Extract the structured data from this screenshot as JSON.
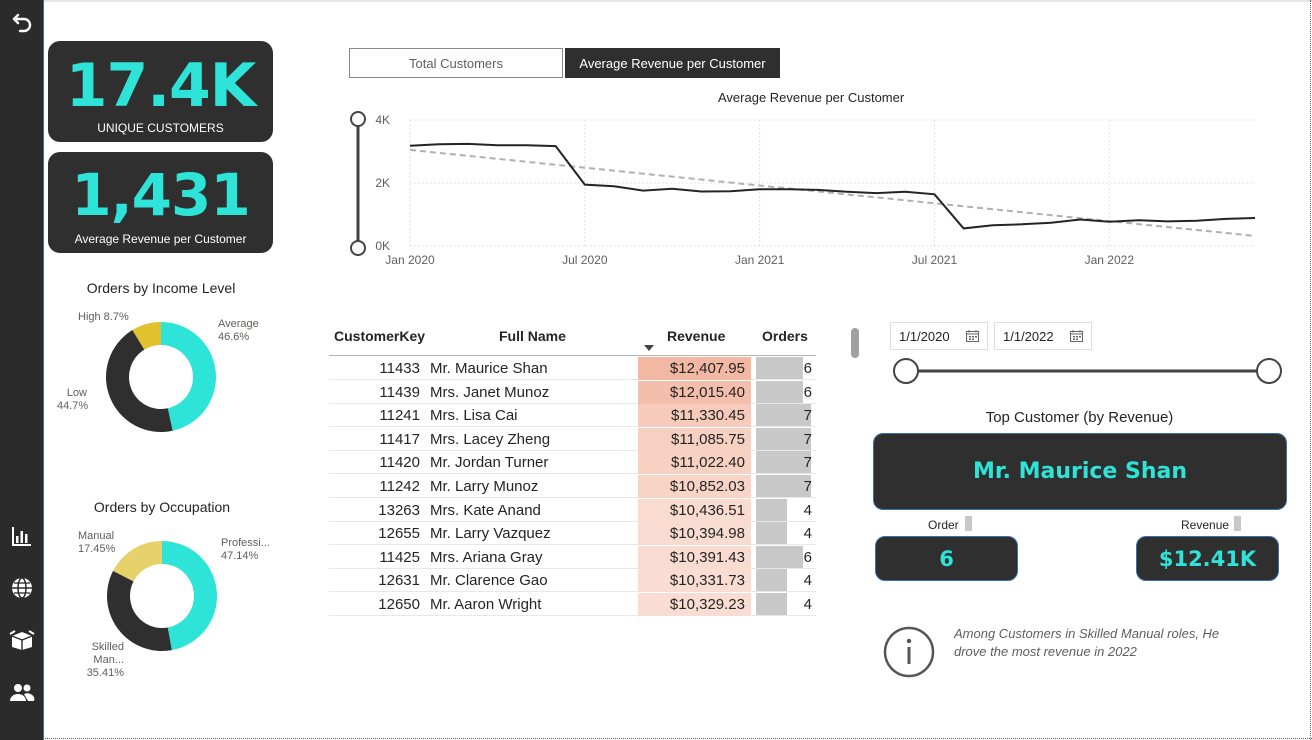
{
  "kpis": {
    "unique_customers": {
      "value": "17.4K",
      "label": "UNIQUE CUSTOMERS"
    },
    "avg_revenue": {
      "value": "1,431",
      "label": "Average Revenue per Customer"
    }
  },
  "sidebar": {
    "icons": [
      "back-arrow-icon",
      "bar-chart-icon",
      "globe-icon",
      "box-icon",
      "users-icon"
    ]
  },
  "donuts": {
    "income": {
      "title": "Orders by Income Level",
      "slices": [
        {
          "name": "Average",
          "pct": "46.6%",
          "value": 46.6,
          "color": "#2ee4d8"
        },
        {
          "name": "Low",
          "pct": "44.7%",
          "value": 44.7,
          "color": "#2f2f2f"
        },
        {
          "name": "High",
          "pct": "8.7%",
          "value": 8.7,
          "color": "#e2c12f"
        }
      ],
      "high_label": "High 8.7%"
    },
    "occupation": {
      "title": "Orders by Occupation",
      "slices": [
        {
          "name": "Professi...",
          "pct": "47.14%",
          "value": 47.14,
          "color": "#2ee4d8"
        },
        {
          "name": "Skilled Man...",
          "pct": "35.41%",
          "value": 35.41,
          "color": "#2f2f2f"
        },
        {
          "name": "Manual",
          "pct": "17.45%",
          "value": 17.45,
          "color": "#e6d26a"
        }
      ]
    }
  },
  "tabs": {
    "total_customers": "Total Customers",
    "avg_revenue": "Average Revenue per Customer",
    "active": "avg_revenue"
  },
  "chart_data": {
    "type": "line",
    "title": "Average Revenue per Customer",
    "x": [
      "2020-01",
      "2020-02",
      "2020-03",
      "2020-04",
      "2020-05",
      "2020-06",
      "2020-07",
      "2020-08",
      "2020-09",
      "2020-10",
      "2020-11",
      "2020-12",
      "2021-01",
      "2021-02",
      "2021-03",
      "2021-04",
      "2021-05",
      "2021-06",
      "2021-07",
      "2021-08",
      "2021-09",
      "2021-10",
      "2021-11",
      "2021-12",
      "2022-01",
      "2022-02",
      "2022-03",
      "2022-04",
      "2022-05",
      "2022-06"
    ],
    "series": [
      {
        "values": [
          3180,
          3230,
          3240,
          3200,
          3200,
          3170,
          1950,
          1900,
          1760,
          1820,
          1730,
          1740,
          1800,
          1800,
          1780,
          1720,
          1680,
          1720,
          1640,
          560,
          660,
          690,
          740,
          840,
          770,
          820,
          780,
          800,
          860,
          890
        ]
      }
    ],
    "trend": {
      "start": 3050,
      "end": 320
    },
    "x_ticks": [
      "Jan 2020",
      "Jul 2020",
      "Jan 2021",
      "Jul 2021",
      "Jan 2022"
    ],
    "y_ticks": [
      "0K",
      "2K",
      "4K"
    ],
    "ylim": [
      0,
      4000
    ],
    "grid": true
  },
  "table": {
    "headers": {
      "key": "CustomerKey",
      "name": "Full Name",
      "revenue": "Revenue",
      "orders": "Orders"
    },
    "rows": [
      {
        "key": "11433",
        "name": "Mr. Maurice Shan",
        "revenue": "$12,407.95",
        "rev_num": 12407.95,
        "orders": "6"
      },
      {
        "key": "11439",
        "name": "Mrs. Janet Munoz",
        "revenue": "$12,015.40",
        "rev_num": 12015.4,
        "orders": "6"
      },
      {
        "key": "11241",
        "name": "Mrs. Lisa Cai",
        "revenue": "$11,330.45",
        "rev_num": 11330.45,
        "orders": "7"
      },
      {
        "key": "11417",
        "name": "Mrs. Lacey Zheng",
        "revenue": "$11,085.75",
        "rev_num": 11085.75,
        "orders": "7"
      },
      {
        "key": "11420",
        "name": "Mr. Jordan Turner",
        "revenue": "$11,022.40",
        "rev_num": 11022.4,
        "orders": "7"
      },
      {
        "key": "11242",
        "name": "Mr. Larry Munoz",
        "revenue": "$10,852.03",
        "rev_num": 10852.03,
        "orders": "7"
      },
      {
        "key": "13263",
        "name": "Mrs. Kate Anand",
        "revenue": "$10,436.51",
        "rev_num": 10436.51,
        "orders": "4"
      },
      {
        "key": "12655",
        "name": "Mr. Larry Vazquez",
        "revenue": "$10,394.98",
        "rev_num": 10394.98,
        "orders": "4"
      },
      {
        "key": "11425",
        "name": "Mrs. Ariana Gray",
        "revenue": "$10,391.43",
        "rev_num": 10391.43,
        "orders": "6"
      },
      {
        "key": "12631",
        "name": "Mr. Clarence Gao",
        "revenue": "$10,331.73",
        "rev_num": 10331.73,
        "orders": "4"
      },
      {
        "key": "12650",
        "name": "Mr. Aaron Wright",
        "revenue": "$10,329.23",
        "rev_num": 10329.23,
        "orders": "4"
      }
    ]
  },
  "date_filter": {
    "start": "1/1/2020",
    "end": "1/1/2022"
  },
  "top_customer": {
    "title": "Top Customer (by Revenue)",
    "name": "Mr. Maurice Shan",
    "order_label": "Order",
    "order_value": "6",
    "revenue_label": "Revenue",
    "revenue_value": "$12.41K"
  },
  "note": {
    "text": "Among Customers in Skilled Manual roles, He drove the most revenue in 2022"
  },
  "colors": {
    "accent": "#2ee4d8",
    "dark": "#2f2f2f",
    "revenue_high": "#f2b8a3",
    "revenue_low": "#f9ddd2"
  }
}
